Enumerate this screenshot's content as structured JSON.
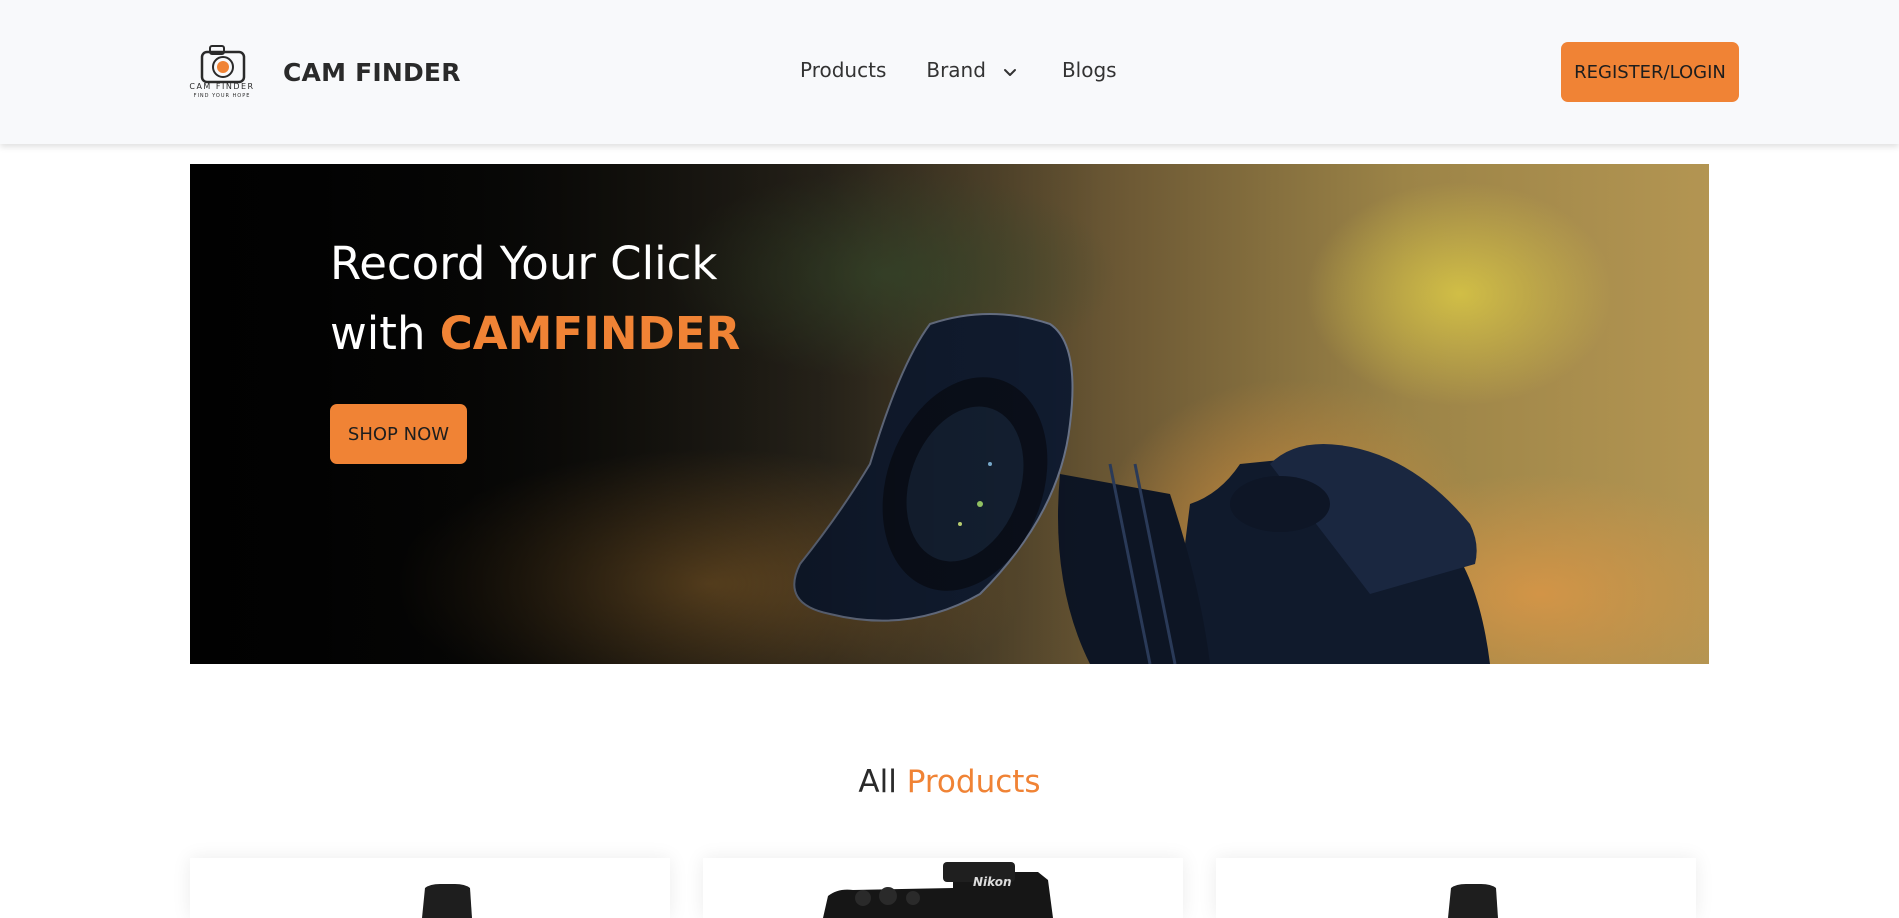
{
  "header": {
    "logo": {
      "icon": "camera-logo-icon",
      "line1": "CAM FINDER",
      "line2": "FIND YOUR HOPE"
    },
    "brand_name": "CAM FINDER",
    "nav": {
      "products": "Products",
      "brand": "Brand",
      "brand_icon": "chevron-down-icon",
      "blogs": "Blogs"
    },
    "register_label": "REGISTER/LOGIN"
  },
  "hero": {
    "line1": "Record Your Click",
    "line2_prefix": "with ",
    "line2_accent": "CAMFINDER",
    "shop_label": "SHOP NOW",
    "image": "camera-lens-photo"
  },
  "products_section": {
    "title_prefix": "All ",
    "title_accent": "Products",
    "cards": [
      {
        "image": "camera-product-image"
      },
      {
        "image": "nikon-camera-product-image",
        "brand_mark": "Nikon"
      },
      {
        "image": "camera-product-image"
      }
    ]
  },
  "colors": {
    "accent": "#f08335",
    "navbar_bg": "#f8f9fb",
    "text_dark": "#2a2a2a"
  }
}
